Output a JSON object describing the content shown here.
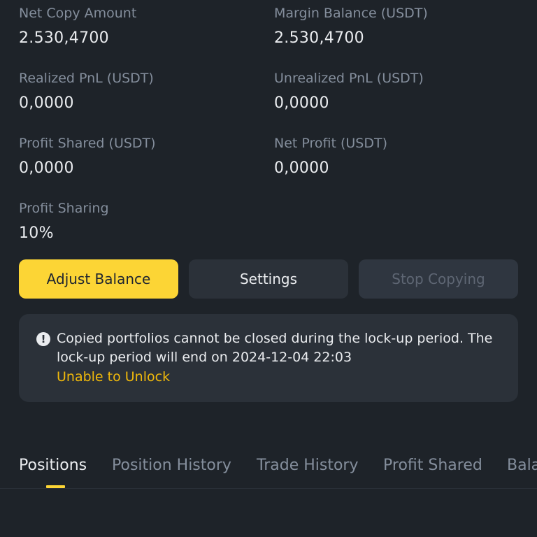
{
  "stats": [
    {
      "label": "Net Copy Amount",
      "value": "2.530,4700"
    },
    {
      "label": "Margin Balance (USDT)",
      "value": "2.530,4700"
    },
    {
      "label": "Realized PnL (USDT)",
      "value": "0,0000"
    },
    {
      "label": "Unrealized PnL (USDT)",
      "value": "0,0000"
    },
    {
      "label": "Profit Shared (USDT)",
      "value": "0,0000"
    },
    {
      "label": "Net Profit (USDT)",
      "value": "0,0000"
    },
    {
      "label": "Profit Sharing",
      "value": "10%"
    }
  ],
  "buttons": {
    "adjust": "Adjust Balance",
    "settings": "Settings",
    "stop": "Stop Copying"
  },
  "notice": {
    "icon": "exclamation-circle-icon",
    "text": "Copied portfolios cannot be closed during the lock-up period. The lock-up period will end on 2024-12-04 22:03",
    "link": "Unable to Unlock"
  },
  "tabs": [
    {
      "label": "Positions",
      "active": true
    },
    {
      "label": "Position History",
      "active": false
    },
    {
      "label": "Trade History",
      "active": false
    },
    {
      "label": "Profit Shared",
      "active": false
    },
    {
      "label": "Bala",
      "active": false
    }
  ],
  "colors": {
    "background": "#1E2329",
    "accent": "#FCD535",
    "link": "#F0B90B",
    "muted": "#848E9C"
  }
}
